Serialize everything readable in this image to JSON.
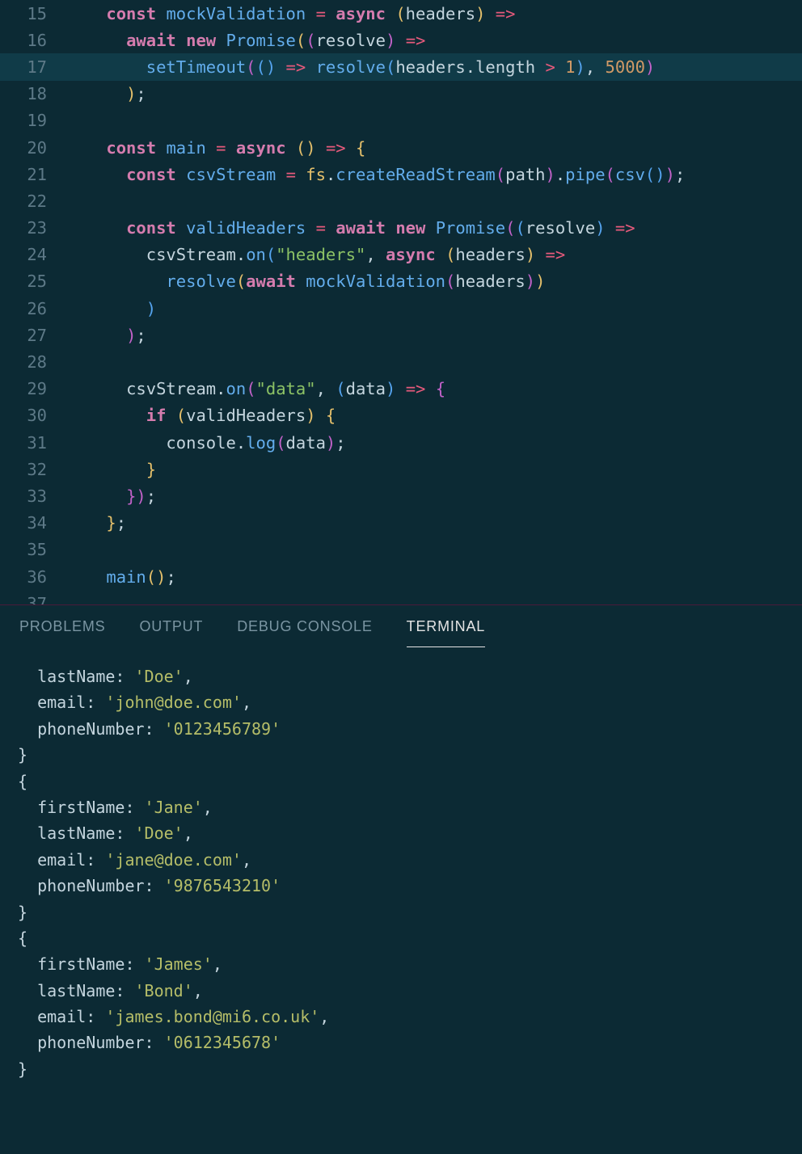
{
  "editor": {
    "startLine": 15,
    "highlightLine": 17,
    "lines": [
      {
        "indent": 1,
        "tokens": [
          [
            "kw",
            "const "
          ],
          [
            "fn",
            "mockValidation"
          ],
          [
            "pr",
            " "
          ],
          [
            "op",
            "="
          ],
          [
            "pr",
            " "
          ],
          [
            "kw",
            "async"
          ],
          [
            "pr",
            " "
          ],
          [
            "par",
            "("
          ],
          [
            "pr",
            "headers"
          ],
          [
            "par",
            ")"
          ],
          [
            "pr",
            " "
          ],
          [
            "op",
            "=>"
          ]
        ]
      },
      {
        "indent": 2,
        "tokens": [
          [
            "kw",
            "await "
          ],
          [
            "kw",
            "new "
          ],
          [
            "mem",
            "Promise"
          ],
          [
            "par",
            "("
          ],
          [
            "par2",
            "("
          ],
          [
            "pr",
            "resolve"
          ],
          [
            "par2",
            ")"
          ],
          [
            "pr",
            " "
          ],
          [
            "op",
            "=>"
          ]
        ]
      },
      {
        "indent": 3,
        "tokens": [
          [
            "mem",
            "setTimeout"
          ],
          [
            "par2",
            "("
          ],
          [
            "par3",
            "("
          ],
          [
            "par3",
            ")"
          ],
          [
            "pr",
            " "
          ],
          [
            "op",
            "=>"
          ],
          [
            "pr",
            " "
          ],
          [
            "mem",
            "resolve"
          ],
          [
            "par3",
            "("
          ],
          [
            "pr",
            "headers"
          ],
          [
            "dot",
            "."
          ],
          [
            "prop",
            "length"
          ],
          [
            "pr",
            " "
          ],
          [
            "op",
            ">"
          ],
          [
            "pr",
            " "
          ],
          [
            "num",
            "1"
          ],
          [
            "par3",
            ")"
          ],
          [
            "opc",
            ", "
          ],
          [
            "num",
            "5000"
          ],
          [
            "par2",
            ")"
          ]
        ]
      },
      {
        "indent": 2,
        "tokens": [
          [
            "par",
            ")"
          ],
          [
            "opc",
            ";"
          ]
        ]
      },
      {
        "indent": 0,
        "tokens": []
      },
      {
        "indent": 1,
        "tokens": [
          [
            "kw",
            "const "
          ],
          [
            "fn",
            "main"
          ],
          [
            "pr",
            " "
          ],
          [
            "op",
            "="
          ],
          [
            "pr",
            " "
          ],
          [
            "kw",
            "async"
          ],
          [
            "pr",
            " "
          ],
          [
            "par",
            "("
          ],
          [
            "par",
            ")"
          ],
          [
            "pr",
            " "
          ],
          [
            "op",
            "=>"
          ],
          [
            "pr",
            " "
          ],
          [
            "brc",
            "{"
          ]
        ]
      },
      {
        "indent": 2,
        "tokens": [
          [
            "kw",
            "const "
          ],
          [
            "fn",
            "csvStream"
          ],
          [
            "pr",
            " "
          ],
          [
            "op",
            "="
          ],
          [
            "pr",
            " "
          ],
          [
            "objY",
            "fs"
          ],
          [
            "dot",
            "."
          ],
          [
            "mem",
            "createReadStream"
          ],
          [
            "par2",
            "("
          ],
          [
            "pr",
            "path"
          ],
          [
            "par2",
            ")"
          ],
          [
            "dot",
            "."
          ],
          [
            "mem",
            "pipe"
          ],
          [
            "par2",
            "("
          ],
          [
            "mem",
            "csv"
          ],
          [
            "par3",
            "("
          ],
          [
            "par3",
            ")"
          ],
          [
            "par2",
            ")"
          ],
          [
            "opc",
            ";"
          ]
        ]
      },
      {
        "indent": 0,
        "tokens": []
      },
      {
        "indent": 2,
        "tokens": [
          [
            "kw",
            "const "
          ],
          [
            "fn",
            "validHeaders"
          ],
          [
            "pr",
            " "
          ],
          [
            "op",
            "="
          ],
          [
            "pr",
            " "
          ],
          [
            "kw",
            "await "
          ],
          [
            "kw",
            "new "
          ],
          [
            "mem",
            "Promise"
          ],
          [
            "par2",
            "("
          ],
          [
            "par3",
            "("
          ],
          [
            "pr",
            "resolve"
          ],
          [
            "par3",
            ")"
          ],
          [
            "pr",
            " "
          ],
          [
            "op",
            "=>"
          ]
        ]
      },
      {
        "indent": 3,
        "tokens": [
          [
            "obj",
            "csvStream"
          ],
          [
            "dot",
            "."
          ],
          [
            "mem",
            "on"
          ],
          [
            "par3",
            "("
          ],
          [
            "str",
            "\"headers\""
          ],
          [
            "opc",
            ", "
          ],
          [
            "kw",
            "async"
          ],
          [
            "pr",
            " "
          ],
          [
            "par",
            "("
          ],
          [
            "pr",
            "headers"
          ],
          [
            "par",
            ")"
          ],
          [
            "pr",
            " "
          ],
          [
            "op",
            "=>"
          ]
        ]
      },
      {
        "indent": 4,
        "tokens": [
          [
            "mem",
            "resolve"
          ],
          [
            "par",
            "("
          ],
          [
            "kw",
            "await "
          ],
          [
            "mem",
            "mockValidation"
          ],
          [
            "par2",
            "("
          ],
          [
            "pr",
            "headers"
          ],
          [
            "par2",
            ")"
          ],
          [
            "par",
            ")"
          ]
        ]
      },
      {
        "indent": 3,
        "tokens": [
          [
            "par3",
            ")"
          ]
        ]
      },
      {
        "indent": 2,
        "tokens": [
          [
            "par2",
            ")"
          ],
          [
            "opc",
            ";"
          ]
        ]
      },
      {
        "indent": 0,
        "tokens": []
      },
      {
        "indent": 2,
        "tokens": [
          [
            "obj",
            "csvStream"
          ],
          [
            "dot",
            "."
          ],
          [
            "mem",
            "on"
          ],
          [
            "par2",
            "("
          ],
          [
            "str",
            "\"data\""
          ],
          [
            "opc",
            ", "
          ],
          [
            "par3",
            "("
          ],
          [
            "pr",
            "data"
          ],
          [
            "par3",
            ")"
          ],
          [
            "pr",
            " "
          ],
          [
            "op",
            "=>"
          ],
          [
            "pr",
            " "
          ],
          [
            "brc2",
            "{"
          ]
        ]
      },
      {
        "indent": 3,
        "tokens": [
          [
            "kw",
            "if "
          ],
          [
            "par",
            "("
          ],
          [
            "pr",
            "validHeaders"
          ],
          [
            "par",
            ")"
          ],
          [
            "pr",
            " "
          ],
          [
            "brc",
            "{"
          ]
        ]
      },
      {
        "indent": 4,
        "tokens": [
          [
            "obj",
            "console"
          ],
          [
            "dot",
            "."
          ],
          [
            "mem",
            "log"
          ],
          [
            "par2",
            "("
          ],
          [
            "pr",
            "data"
          ],
          [
            "par2",
            ")"
          ],
          [
            "opc",
            ";"
          ]
        ]
      },
      {
        "indent": 3,
        "tokens": [
          [
            "brc",
            "}"
          ]
        ]
      },
      {
        "indent": 2,
        "tokens": [
          [
            "brc2",
            "}"
          ],
          [
            "par2",
            ")"
          ],
          [
            "opc",
            ";"
          ]
        ]
      },
      {
        "indent": 1,
        "tokens": [
          [
            "brc",
            "}"
          ],
          [
            "opc",
            ";"
          ]
        ]
      },
      {
        "indent": 0,
        "tokens": []
      },
      {
        "indent": 1,
        "tokens": [
          [
            "mem",
            "main"
          ],
          [
            "par",
            "("
          ],
          [
            "par",
            ")"
          ],
          [
            "opc",
            ";"
          ]
        ]
      },
      {
        "indent": 0,
        "tokens": []
      }
    ]
  },
  "panel": {
    "tabs": [
      "PROBLEMS",
      "OUTPUT",
      "DEBUG CONSOLE",
      "TERMINAL"
    ],
    "activeTab": 3,
    "terminalOutput": [
      {
        "type": "kv",
        "indent": 1,
        "key": "lastName",
        "val": "'Doe'",
        "comma": true
      },
      {
        "type": "kv",
        "indent": 1,
        "key": "email",
        "val": "'john@doe.com'",
        "comma": true
      },
      {
        "type": "kv",
        "indent": 1,
        "key": "phoneNumber",
        "val": "'0123456789'",
        "comma": false
      },
      {
        "type": "plain",
        "text": "}"
      },
      {
        "type": "plain",
        "text": "{"
      },
      {
        "type": "kv",
        "indent": 1,
        "key": "firstName",
        "val": "'Jane'",
        "comma": true
      },
      {
        "type": "kv",
        "indent": 1,
        "key": "lastName",
        "val": "'Doe'",
        "comma": true
      },
      {
        "type": "kv",
        "indent": 1,
        "key": "email",
        "val": "'jane@doe.com'",
        "comma": true
      },
      {
        "type": "kv",
        "indent": 1,
        "key": "phoneNumber",
        "val": "'9876543210'",
        "comma": false
      },
      {
        "type": "plain",
        "text": "}"
      },
      {
        "type": "plain",
        "text": "{"
      },
      {
        "type": "kv",
        "indent": 1,
        "key": "firstName",
        "val": "'James'",
        "comma": true
      },
      {
        "type": "kv",
        "indent": 1,
        "key": "lastName",
        "val": "'Bond'",
        "comma": true
      },
      {
        "type": "kv",
        "indent": 1,
        "key": "email",
        "val": "'james.bond@mi6.co.uk'",
        "comma": true
      },
      {
        "type": "kv",
        "indent": 1,
        "key": "phoneNumber",
        "val": "'0612345678'",
        "comma": false
      },
      {
        "type": "plain",
        "text": "}"
      }
    ]
  }
}
